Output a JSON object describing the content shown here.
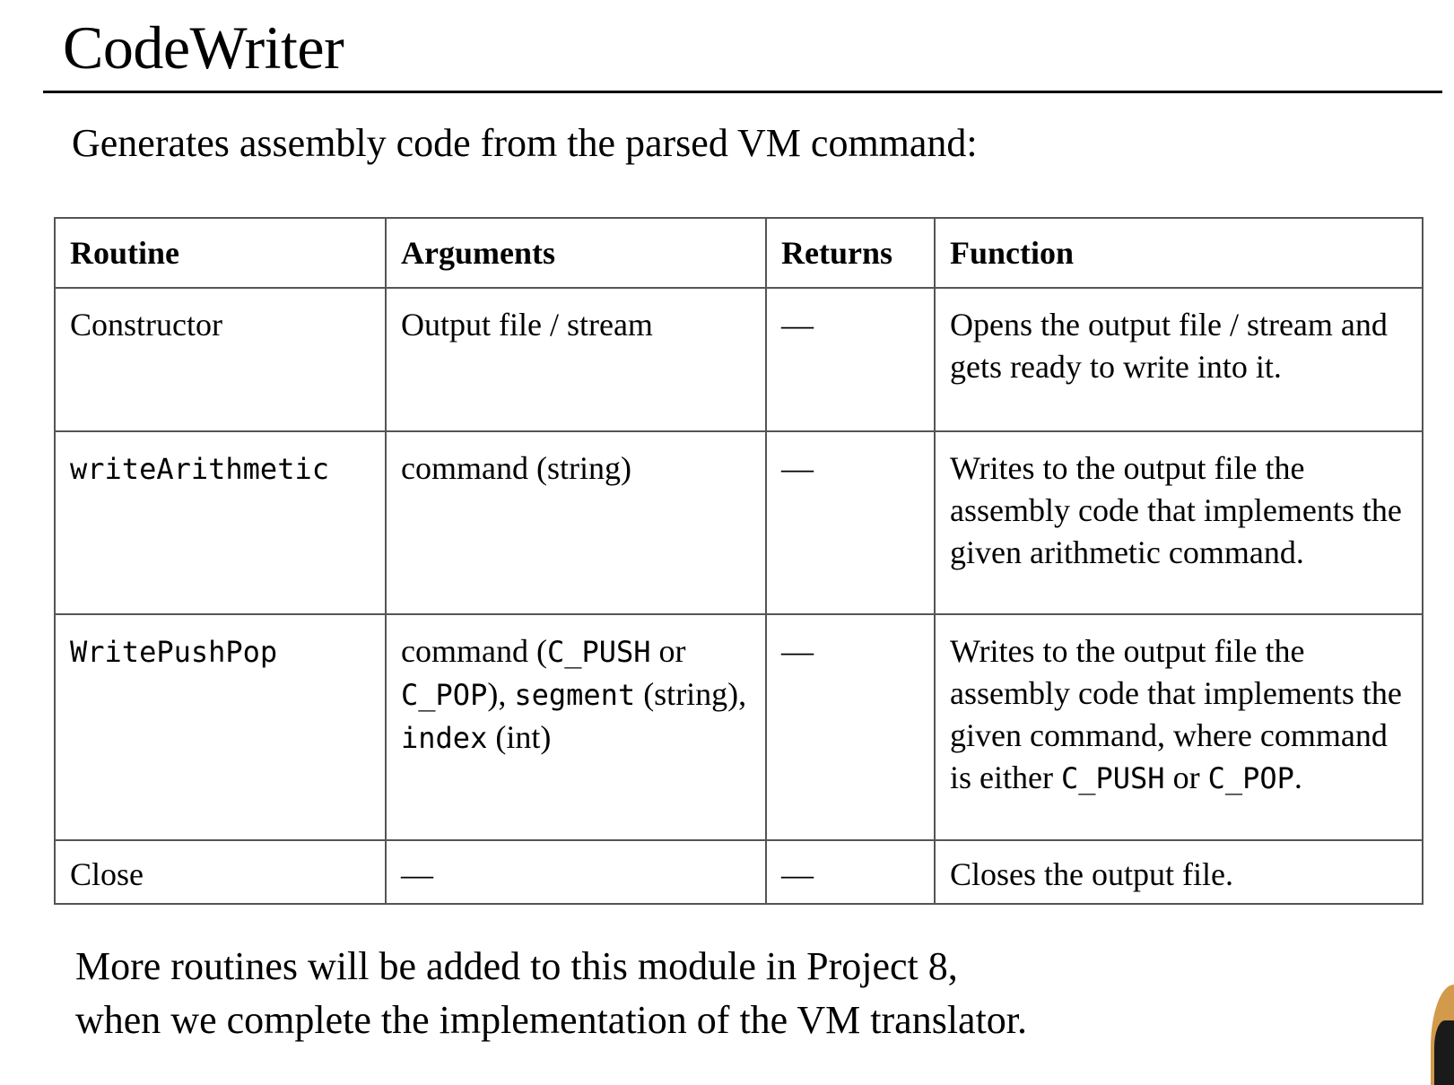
{
  "slide": {
    "title": "CodeWriter",
    "subtitle": "Generates assembly code from the parsed VM command:",
    "table": {
      "headers": [
        "Routine",
        "Arguments",
        "Returns",
        "Function"
      ],
      "rows": [
        {
          "routine": "Constructor",
          "arguments": "Output file / stream",
          "returns": "—",
          "function": "Opens the output file / stream and gets ready to write into it."
        },
        {
          "routine": "writeArithmetic",
          "arguments": "command (string)",
          "returns": "—",
          "function": "Writes to the output file the assembly code that implements the given arithmetic command."
        },
        {
          "routine": "WritePushPop",
          "arguments": {
            "part1": "command (",
            "code1": "C_PUSH",
            "part2": " or ",
            "code2": "C_POP",
            "part3": "), ",
            "code3": "segment",
            "part4": " (string), ",
            "code4": "index",
            "part5": " (int)"
          },
          "returns": "—",
          "function": {
            "text": "Writes to the output file the assembly code that implements the given command, where command is either ",
            "code1": "C_PUSH",
            "mid": " or ",
            "code2": "C_POP",
            "end": "."
          }
        },
        {
          "routine": "Close",
          "arguments": "—",
          "returns": "—",
          "function": "Closes the output file."
        }
      ]
    },
    "footer": {
      "line1": "More routines will be added to this module in Project 8,",
      "line2": "when we complete the implementation of the VM translator."
    }
  }
}
